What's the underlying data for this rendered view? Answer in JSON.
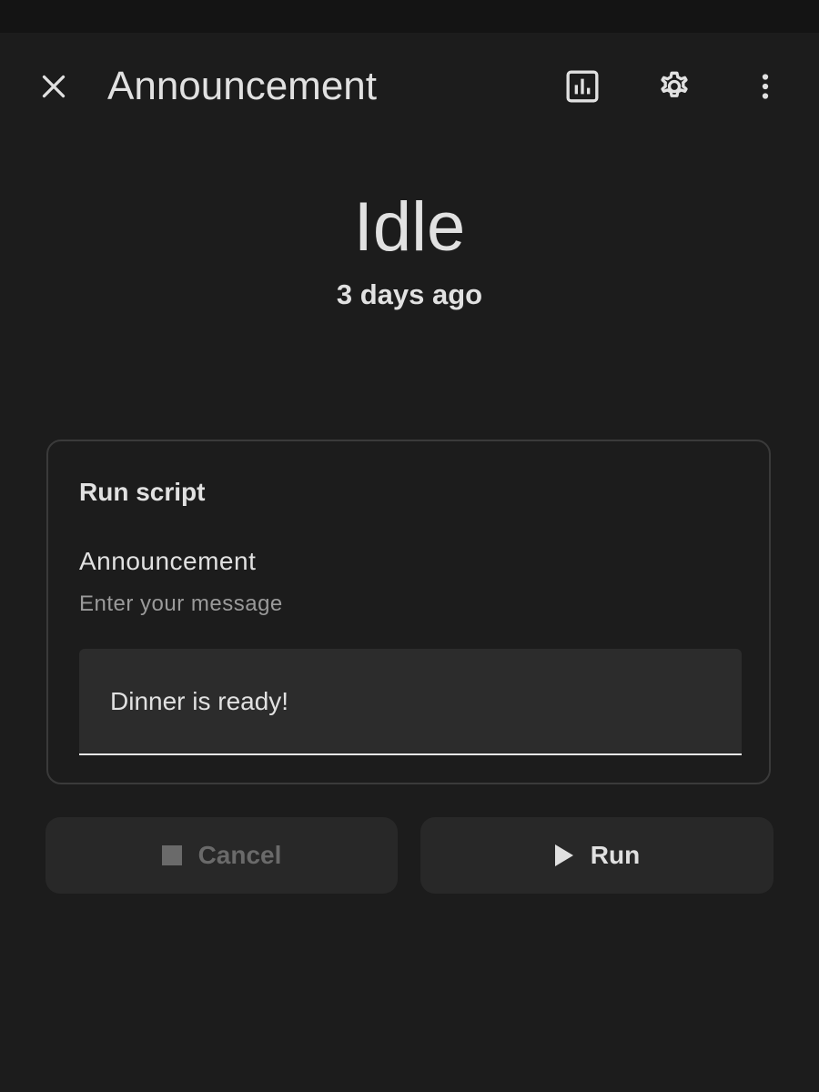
{
  "app_bar": {
    "title": "Announcement",
    "icons": {
      "close": "close-icon",
      "history": "chart-box-icon",
      "settings": "gear-icon",
      "more": "dots-vertical-icon"
    }
  },
  "state": {
    "value": "Idle",
    "last_changed": "3 days ago"
  },
  "card": {
    "title": "Run script",
    "field": {
      "label": "Announcement",
      "description": "Enter your message",
      "value": "Dinner is ready!"
    }
  },
  "actions": {
    "cancel_label": "Cancel",
    "cancel_icon": "stop-icon",
    "run_label": "Run",
    "run_icon": "play-icon"
  },
  "colors": {
    "background": "#1c1c1c",
    "surface": "#282828",
    "field_fill": "#2c2c2c",
    "text_primary": "#e1e1e1",
    "text_secondary": "#9a9a9a",
    "text_disabled": "#6a6a6a"
  }
}
